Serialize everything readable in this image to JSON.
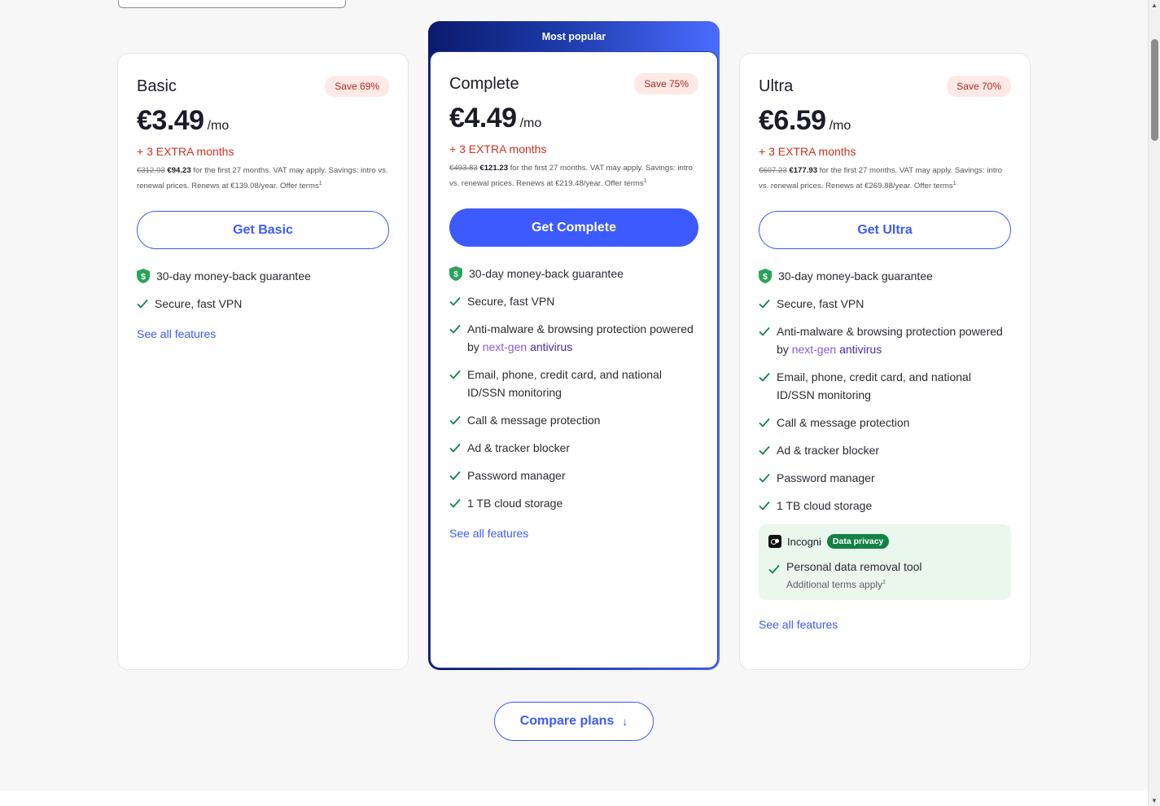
{
  "plans": [
    {
      "name": "Basic",
      "save": "Save 69%",
      "price": "€3.49",
      "per": "/mo",
      "extra": "+ 3 EXTRA months",
      "old_price": "€312.93",
      "new_price": "€94.23",
      "fine_text": "for the first 27 months. VAT may apply. Savings: intro vs. renewal prices. Renews at €139.08/year. Offer terms",
      "fine_sup": "1",
      "cta": "Get Basic",
      "guarantee": "30-day money-back guarantee",
      "features": [
        "Secure, fast VPN"
      ],
      "see_all": "See all features"
    },
    {
      "ribbon": "Most popular",
      "name": "Complete",
      "save": "Save 75%",
      "price": "€4.49",
      "per": "/mo",
      "extra": "+ 3 EXTRA months",
      "old_price": "€493.83",
      "new_price": "€121.23",
      "fine_text": "for the first 27 months. VAT may apply. Savings: intro vs. renewal prices. Renews at €219.48/year. Offer terms",
      "fine_sup": "1",
      "cta": "Get Complete",
      "guarantee": "30-day money-back guarantee",
      "features": [
        "Secure, fast VPN",
        "Anti-malware & browsing protection powered by",
        "Email, phone, credit card, and national ID/SSN monitoring",
        "Call & message protection",
        "Ad & tracker blocker",
        "Password manager",
        "1 TB cloud storage"
      ],
      "antivirus_a": "next-gen",
      "antivirus_b": "antivirus",
      "see_all": "See all features"
    },
    {
      "name": "Ultra",
      "save": "Save 70%",
      "price": "€6.59",
      "per": "/mo",
      "extra": "+ 3 EXTRA months",
      "old_price": "€607.23",
      "new_price": "€177.93",
      "fine_text": "for the first 27 months. VAT may apply. Savings: intro vs. renewal prices. Renews at €269.88/year. Offer terms",
      "fine_sup": "1",
      "cta": "Get Ultra",
      "guarantee": "30-day money-back guarantee",
      "features": [
        "Secure, fast VPN",
        "Anti-malware & browsing protection powered by",
        "Email, phone, credit card, and national ID/SSN monitoring",
        "Call & message protection",
        "Ad & tracker blocker",
        "Password manager",
        "1 TB cloud storage"
      ],
      "antivirus_a": "next-gen",
      "antivirus_b": "antivirus",
      "incogni": {
        "brand": "Incogni",
        "badge": "Data privacy",
        "item": "Personal data removal tool",
        "sub": "Additional terms apply",
        "sub_sup": "2"
      },
      "see_all": "See all features"
    }
  ],
  "compare": {
    "label": "Compare plans",
    "arrow": "↓"
  },
  "colors": {
    "accent": "#3d5afe",
    "check": "#128245",
    "save_text": "#b0281f",
    "extra": "#d2311f"
  }
}
